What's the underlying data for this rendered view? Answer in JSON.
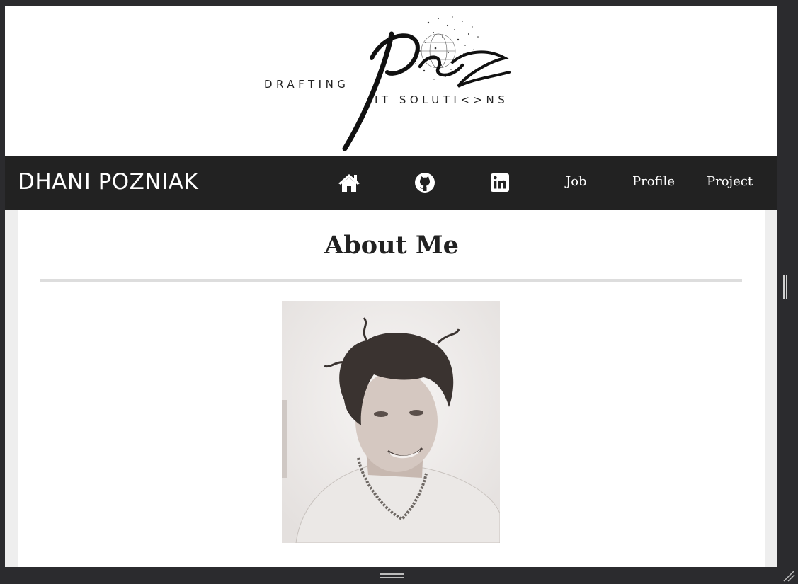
{
  "logo": {
    "monogram": "pcz",
    "left_text": "DRAFTING",
    "right_text": "IT SOLUTI<>NS"
  },
  "navbar": {
    "site_name": "DHANI POZNIAK",
    "icons": [
      "home-icon",
      "github-icon",
      "linkedin-icon"
    ],
    "links": [
      "Job",
      "Profile",
      "Project"
    ]
  },
  "about": {
    "title": "About Me",
    "photo": "portrait-photo"
  },
  "colors": {
    "navbar_bg": "#222222",
    "nav_text": "#ffffff",
    "page_bg": "#eeeeee",
    "card_bg": "#ffffff",
    "title_text": "#222222",
    "divider": "#dddddd",
    "window_chrome": "#2b2b2e"
  }
}
